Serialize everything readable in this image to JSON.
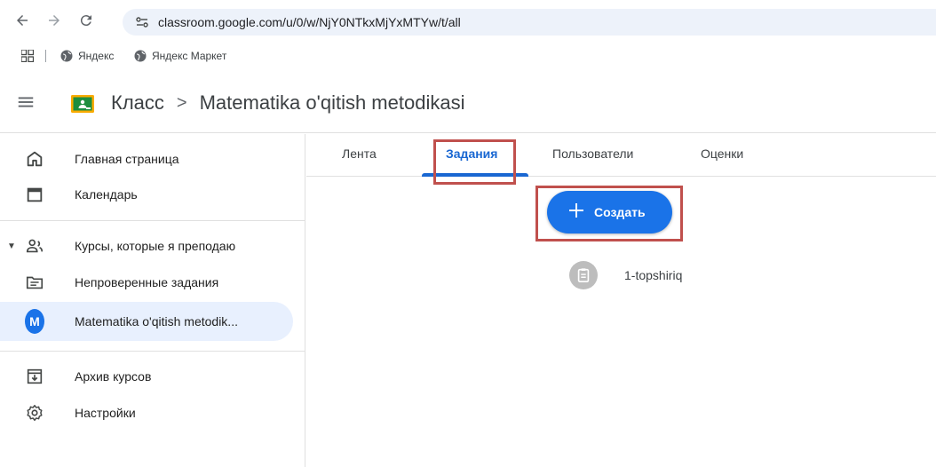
{
  "browser": {
    "url": "classroom.google.com/u/0/w/NjY0NTkxMjYxMTYw/t/all",
    "bookmarks": [
      "Яндекс",
      "Яндекс Маркет"
    ]
  },
  "header": {
    "app_name": "Класс",
    "separator": ">",
    "course_title": "Matematika o'qitish metodikasi"
  },
  "sidebar": {
    "items": [
      {
        "label": "Главная страница",
        "icon": "home-icon"
      },
      {
        "label": "Календарь",
        "icon": "calendar-icon"
      },
      {
        "label": "Курсы, которые я преподаю",
        "icon": "people-icon"
      },
      {
        "label": "Непроверенные задания",
        "icon": "folder-icon"
      },
      {
        "label": "Matematika o'qitish metodik...",
        "icon": "avatar",
        "avatar_letter": "M",
        "active": true
      },
      {
        "label": "Архив курсов",
        "icon": "archive-icon"
      },
      {
        "label": "Настройки",
        "icon": "gear-icon"
      }
    ]
  },
  "tabs": [
    "Лента",
    "Задания",
    "Пользователи",
    "Оценки"
  ],
  "active_tab": "Задания",
  "create_button": {
    "label": "Создать"
  },
  "assignments": [
    {
      "title": "1-topshiriq",
      "icon": "assignment-icon"
    }
  ],
  "colors": {
    "accent": "#1a73e8",
    "active_tab": "#1967d2",
    "highlight_box": "#c0504d",
    "active_item_bg": "#e8f0fe"
  }
}
